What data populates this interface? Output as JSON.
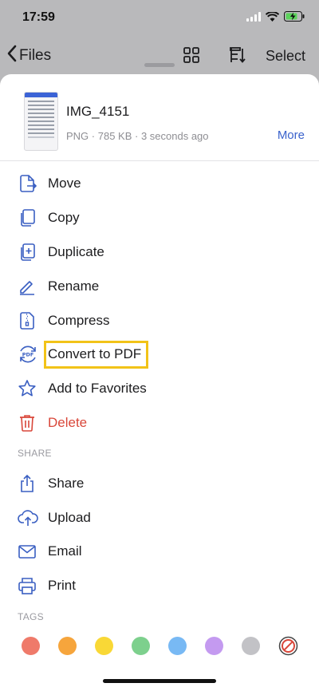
{
  "status": {
    "time": "17:59"
  },
  "nav": {
    "back_label": "Files",
    "select_label": "Select"
  },
  "file": {
    "name": "IMG_4151",
    "type": "PNG",
    "size": "785 KB",
    "modified": "3 seconds ago",
    "separator": " · ",
    "more_label": "More"
  },
  "menu": [
    {
      "label": "Move",
      "icon": "move-icon"
    },
    {
      "label": "Copy",
      "icon": "copy-icon"
    },
    {
      "label": "Duplicate",
      "icon": "duplicate-icon"
    },
    {
      "label": "Rename",
      "icon": "rename-pencil-icon"
    },
    {
      "label": "Compress",
      "icon": "compress-zip-icon"
    },
    {
      "label": "Convert to PDF",
      "icon": "convert-pdf-icon",
      "highlighted": true
    },
    {
      "label": "Add to Favorites",
      "icon": "star-icon"
    },
    {
      "label": "Delete",
      "icon": "trash-icon",
      "danger": true
    }
  ],
  "share_section": {
    "title": "SHARE",
    "items": [
      {
        "label": "Share",
        "icon": "share-icon"
      },
      {
        "label": "Upload",
        "icon": "upload-cloud-icon"
      },
      {
        "label": "Email",
        "icon": "envelope-icon"
      },
      {
        "label": "Print",
        "icon": "printer-icon"
      }
    ]
  },
  "tags_section": {
    "title": "TAGS",
    "colors": [
      "#ef7a6a",
      "#f6a53c",
      "#f9d836",
      "#7dd08d",
      "#78b9f4",
      "#c49af0",
      "#c2c2c6"
    ],
    "none_icon": "no-tag-icon"
  },
  "colors": {
    "accent": "#3a62cc",
    "icon_blue": "#3a5fc2",
    "danger": "#d9473a",
    "highlight": "#f2c318"
  }
}
